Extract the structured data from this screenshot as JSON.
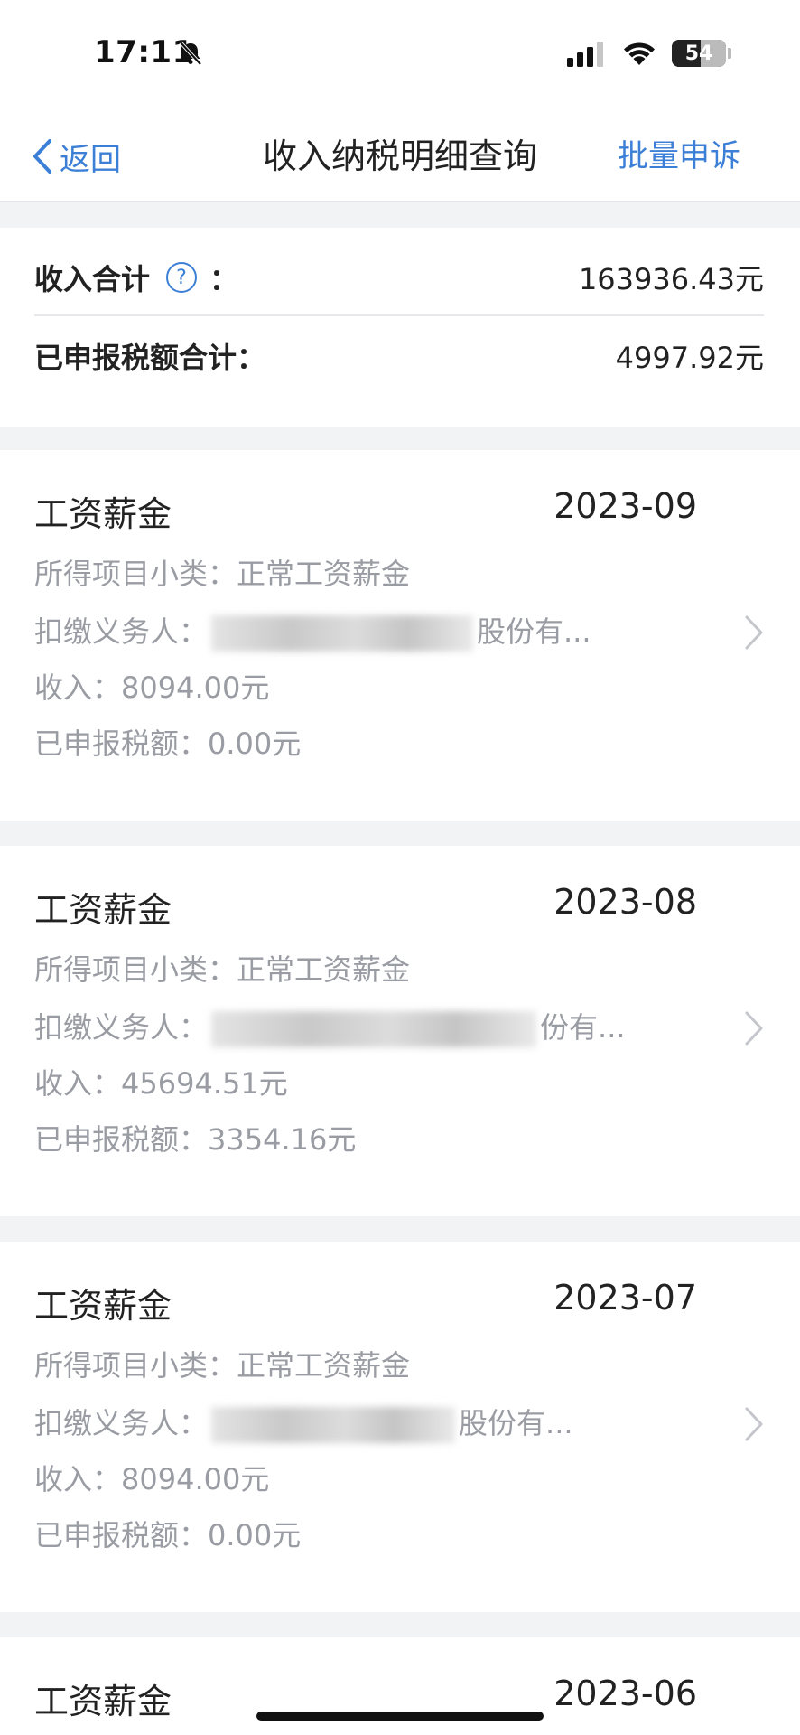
{
  "status_bar": {
    "time": "17:11",
    "battery": "54",
    "battery_level_percent": 54
  },
  "nav": {
    "back_label": "返回",
    "title": "收入纳税明细查询",
    "action_label": "批量申诉"
  },
  "summary": {
    "income_label": "收入合计",
    "income_colon": "：",
    "income_value": "163936.43元",
    "tax_label": "已申报税额合计：",
    "tax_value": "4997.92元"
  },
  "labels": {
    "subcategory_prefix": "所得项目小类：",
    "withholder_prefix": "扣缴义务人：",
    "income_prefix": "收入：",
    "tax_prefix": "已申报税额："
  },
  "records": [
    {
      "type": "工资薪金",
      "date": "2023-09",
      "subcategory": "正常工资薪金",
      "withholder_suffix": "股份有...",
      "income": "8094.00元",
      "tax": "0.00元"
    },
    {
      "type": "工资薪金",
      "date": "2023-08",
      "subcategory": "正常工资薪金",
      "withholder_suffix": "份有...",
      "income": "45694.51元",
      "tax": "3354.16元"
    },
    {
      "type": "工资薪金",
      "date": "2023-07",
      "subcategory": "正常工资薪金",
      "withholder_suffix": "股份有...",
      "income": "8094.00元",
      "tax": "0.00元"
    },
    {
      "type": "工资薪金",
      "date": "2023-06"
    }
  ]
}
